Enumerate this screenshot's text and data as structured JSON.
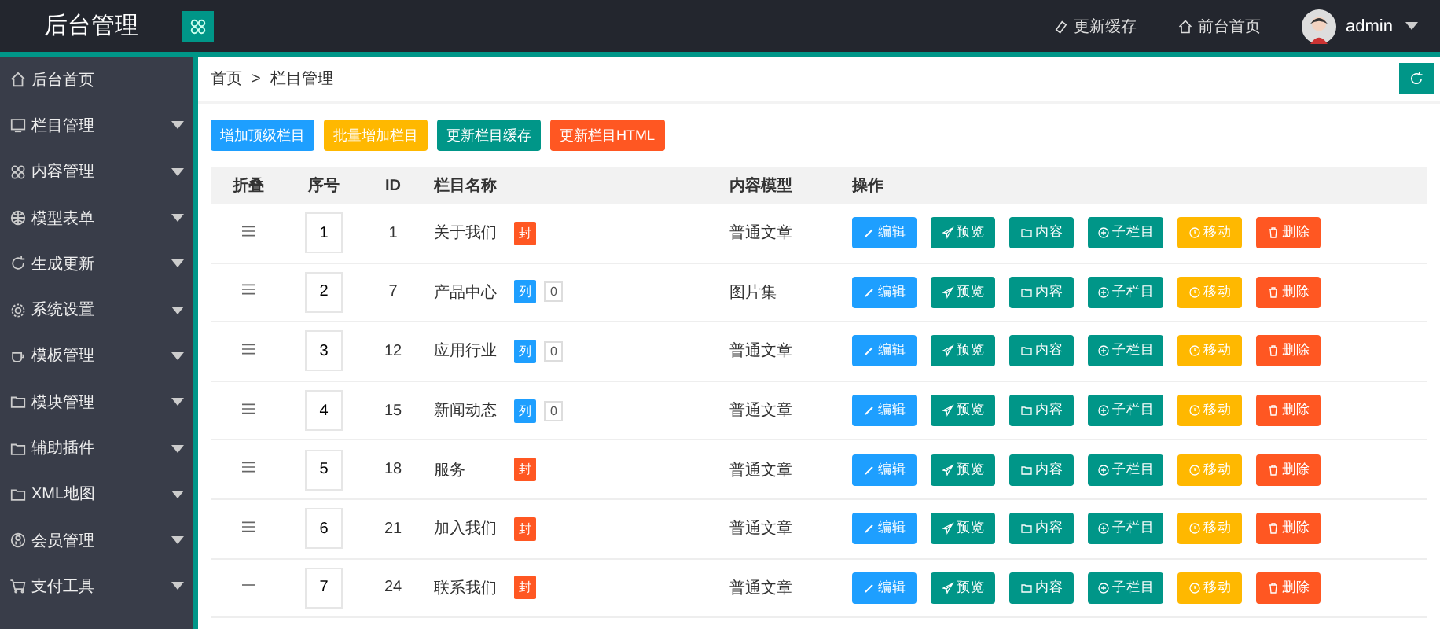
{
  "header": {
    "logo": "后台管理",
    "links": [
      "更新缓存",
      "前台首页"
    ],
    "user": "admin"
  },
  "sidebar": {
    "items": [
      {
        "label": "后台首页",
        "has_submenu": false
      },
      {
        "label": "栏目管理",
        "has_submenu": true
      },
      {
        "label": "内容管理",
        "has_submenu": true
      },
      {
        "label": "模型表单",
        "has_submenu": true
      },
      {
        "label": "生成更新",
        "has_submenu": true
      },
      {
        "label": "系统设置",
        "has_submenu": true
      },
      {
        "label": "模板管理",
        "has_submenu": true
      },
      {
        "label": "模块管理",
        "has_submenu": true
      },
      {
        "label": "辅助插件",
        "has_submenu": true
      },
      {
        "label": "XML地图",
        "has_submenu": true
      },
      {
        "label": "会员管理",
        "has_submenu": true
      },
      {
        "label": "支付工具",
        "has_submenu": true
      }
    ]
  },
  "breadcrumb": [
    "首页",
    ">",
    "栏目管理"
  ],
  "toolbar": [
    {
      "label": "增加顶级栏目",
      "color": "#1e9fff"
    },
    {
      "label": "批量增加栏目",
      "color": "#ffb800"
    },
    {
      "label": "更新栏目缓存",
      "color": "#009688"
    },
    {
      "label": "更新栏目HTML",
      "color": "#ff5722"
    }
  ],
  "table": {
    "columns": [
      "折叠",
      "序号",
      "ID",
      "栏目名称",
      "内容模型",
      "操作"
    ],
    "rows": [
      {
        "collapsible": true,
        "order": "1",
        "id": "1",
        "name": "关于我们",
        "tag": {
          "kind": "single",
          "text": "封"
        },
        "model": "普通文章",
        "actions": [
          "编辑",
          "预览",
          "内容",
          "子栏目",
          "移动",
          "删除"
        ]
      },
      {
        "collapsible": true,
        "order": "2",
        "id": "7",
        "name": "产品中心",
        "tag": {
          "kind": "list",
          "text": "列",
          "count": "0"
        },
        "model": "图片集",
        "actions": [
          "编辑",
          "预览",
          "内容",
          "子栏目",
          "移动",
          "删除"
        ]
      },
      {
        "collapsible": true,
        "order": "3",
        "id": "12",
        "name": "应用行业",
        "tag": {
          "kind": "list",
          "text": "列",
          "count": "0"
        },
        "model": "普通文章",
        "actions": [
          "编辑",
          "预览",
          "内容",
          "子栏目",
          "移动",
          "删除"
        ]
      },
      {
        "collapsible": true,
        "order": "4",
        "id": "15",
        "name": "新闻动态",
        "tag": {
          "kind": "list",
          "text": "列",
          "count": "0"
        },
        "model": "普通文章",
        "actions": [
          "编辑",
          "预览",
          "内容",
          "子栏目",
          "移动",
          "删除"
        ]
      },
      {
        "collapsible": true,
        "order": "5",
        "id": "18",
        "name": "服务",
        "tag": {
          "kind": "single",
          "text": "封"
        },
        "model": "普通文章",
        "actions": [
          "编辑",
          "预览",
          "内容",
          "子栏目",
          "移动",
          "删除"
        ]
      },
      {
        "collapsible": true,
        "order": "6",
        "id": "21",
        "name": "加入我们",
        "tag": {
          "kind": "single",
          "text": "封"
        },
        "model": "普通文章",
        "actions": [
          "编辑",
          "预览",
          "内容",
          "子栏目",
          "移动",
          "删除"
        ]
      },
      {
        "collapsible": false,
        "order": "7",
        "id": "24",
        "name": "联系我们",
        "tag": {
          "kind": "single",
          "text": "封"
        },
        "model": "普通文章",
        "actions": [
          "编辑",
          "预览",
          "内容",
          "子栏目",
          "移动",
          "删除"
        ]
      }
    ]
  }
}
